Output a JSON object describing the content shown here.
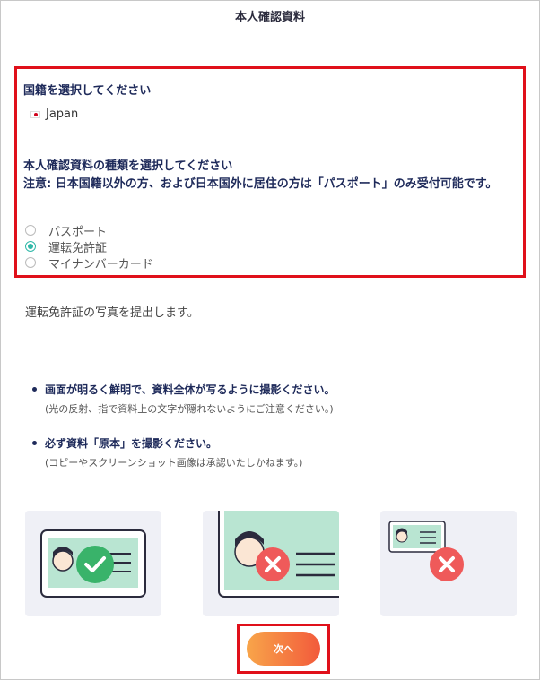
{
  "header": {
    "title": "本人確認資料"
  },
  "nationality": {
    "heading": "国籍を選択してください",
    "selected": "Japan"
  },
  "document_type": {
    "heading": "本人確認資料の種類を選択してください",
    "note": "注意: 日本国籍以外の方、および日本国外に居住の方は「パスポート」のみ受付可能です。",
    "options": [
      "パスポート",
      "運転免許証",
      "マイナンバーカード"
    ],
    "selected_index": 1
  },
  "instruction": "運転免許証の写真を提出します。",
  "tips": [
    {
      "main": "画面が明るく鮮明で、資料全体が写るように撮影ください。",
      "sub": "(光の反射、指で資料上の文字が隠れないようにご注意ください。)"
    },
    {
      "main": "必ず資料「原本」を撮影ください。",
      "sub": "(コピーやスクリーンショット画像は承認いたしかねます。)"
    }
  ],
  "examples": [
    {
      "icon": "check-icon",
      "status": "good"
    },
    {
      "icon": "cross-icon",
      "status": "bad"
    },
    {
      "icon": "cross-icon",
      "status": "bad"
    }
  ],
  "colors": {
    "accent": "#2fb8a8",
    "highlight": "#e0101a",
    "ok": "#39b36a",
    "ng": "#ef5a5a",
    "button_start": "#f8a54a",
    "button_end": "#f25a3b"
  },
  "next_button": {
    "label": "次へ"
  }
}
